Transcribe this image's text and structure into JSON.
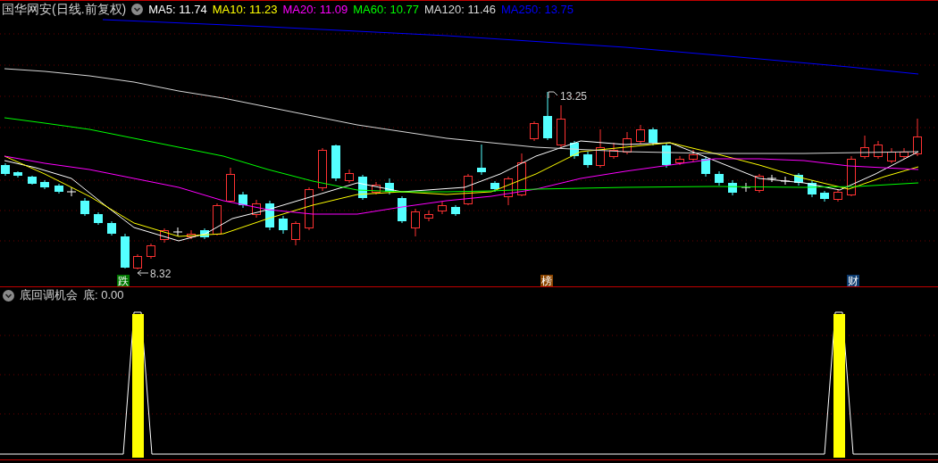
{
  "header": {
    "title": "国华网安(日线.前复权)",
    "indicators": [
      {
        "label": "MA5: 11.74",
        "color": "#ffffff"
      },
      {
        "label": "MA10: 11.23",
        "color": "#ffff00"
      },
      {
        "label": "MA20: 11.09",
        "color": "#ff00ff"
      },
      {
        "label": "MA60: 10.77",
        "color": "#00ff00"
      },
      {
        "label": "MA120: 11.46",
        "color": "#d8d8d8"
      },
      {
        "label": "MA250: 13.75",
        "color": "#0000ff"
      }
    ]
  },
  "price_chart": {
    "high_label": "13.25",
    "low_label": "8.32",
    "markers": [
      {
        "text": "跌",
        "color": "#007700"
      },
      {
        "text": "榜",
        "color": "#8b4500"
      },
      {
        "text": "财",
        "color": "#0b3a6e"
      }
    ]
  },
  "indicator_panel": {
    "title": "底回调机会",
    "value": "底: 0.00"
  }
}
